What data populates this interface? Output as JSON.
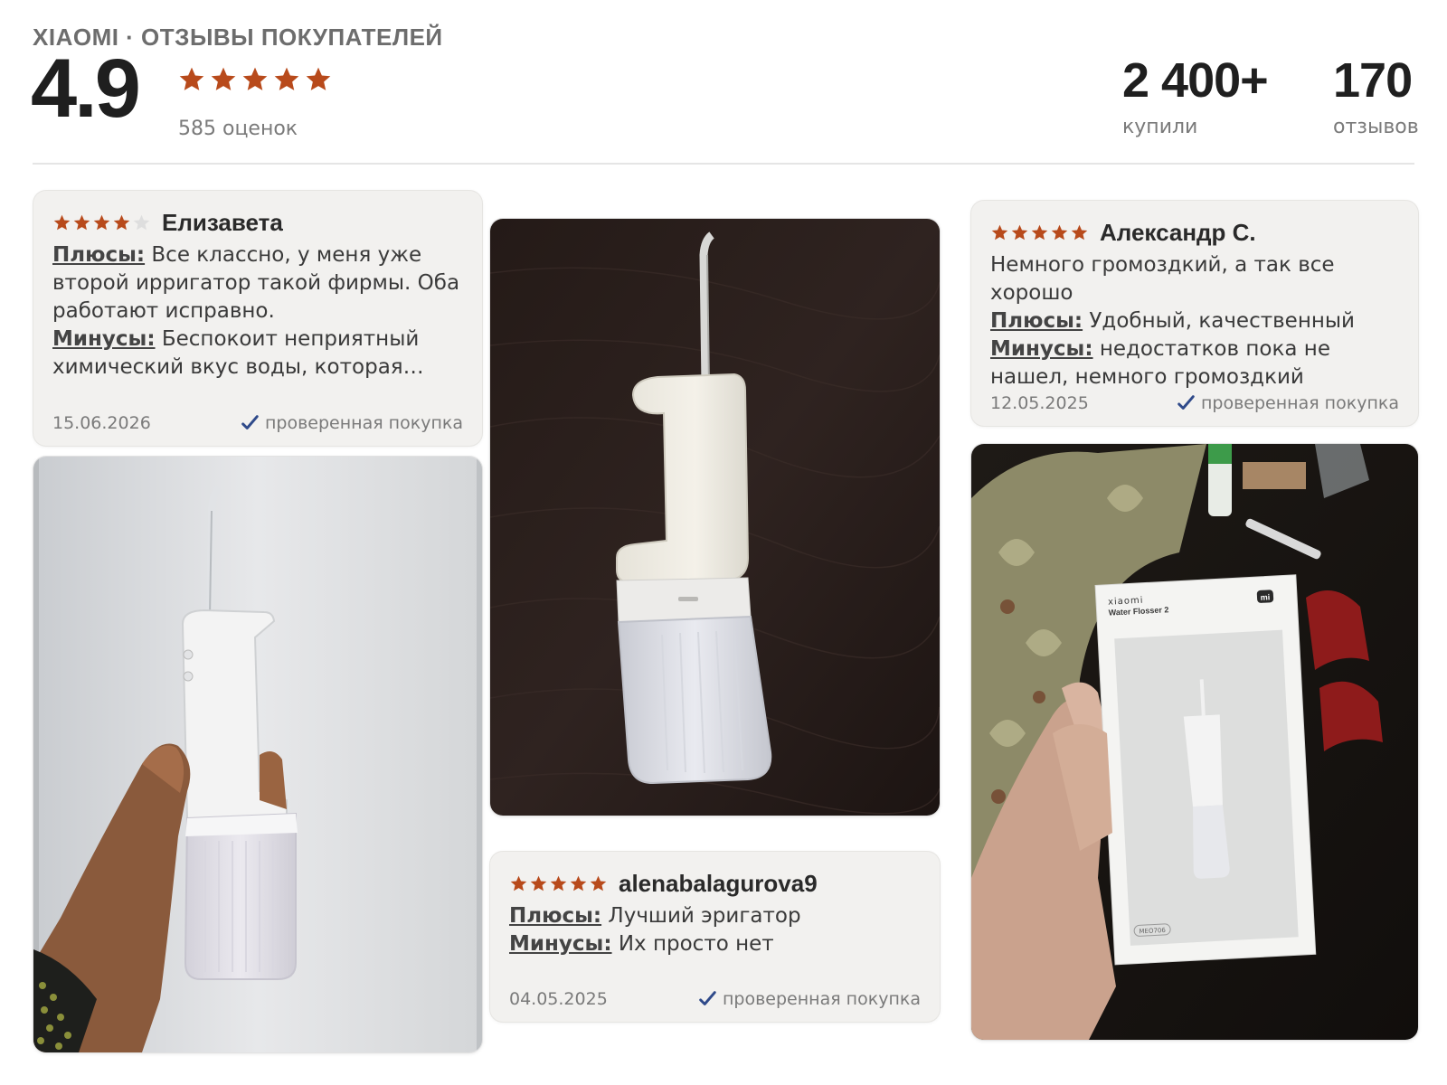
{
  "header": {
    "brand_line": "XIAOMI · ОТЗЫВЫ ПОКУПАТЕЛЕЙ",
    "rating": "4.9",
    "stars": 5,
    "ratings_count": "585 оценок",
    "bought_value": "2 400+",
    "bought_label": "купили",
    "reviews_value": "170",
    "reviews_label": "отзывов"
  },
  "reviews": [
    {
      "author": "Елизавета",
      "stars": 4,
      "lead": "",
      "pros_label": "Плюсы:",
      "pros": "Все классно, у меня уже второй ирригатор такой фирмы. Оба работают исправно.",
      "cons_label": "Минусы:",
      "cons": "Беспокоит неприятный химический вкус воды, которая…",
      "date": "15.06.2026",
      "verified": "проверенная покупка"
    },
    {
      "author": "Александр С.",
      "stars": 5,
      "lead": "Немного громоздкий, а так все хорошо",
      "pros_label": "Плюсы:",
      "pros": "Удобный, качественный",
      "cons_label": "Минусы:",
      "cons": "недостатков пока не нашел, немного громоздкий",
      "date": "12.05.2025",
      "verified": "проверенная покупка"
    },
    {
      "author": "alenabalagurova9",
      "stars": 5,
      "lead": "",
      "pros_label": "Плюсы:",
      "pros": "Лучший эригатор",
      "cons_label": "Минусы:",
      "cons": "Их просто нет",
      "date": "04.05.2025",
      "verified": "проверенная покупка"
    }
  ],
  "box_print": {
    "brand": "xiaomi",
    "product": "Water Flosser 2",
    "model": "MEO706",
    "logo": "mi"
  },
  "icons": {
    "star": "star-icon",
    "verified": "checkmark-icon"
  },
  "colors": {
    "star_filled": "#b84a1b",
    "star_empty": "#dedede",
    "check": "#2f4a8a"
  }
}
